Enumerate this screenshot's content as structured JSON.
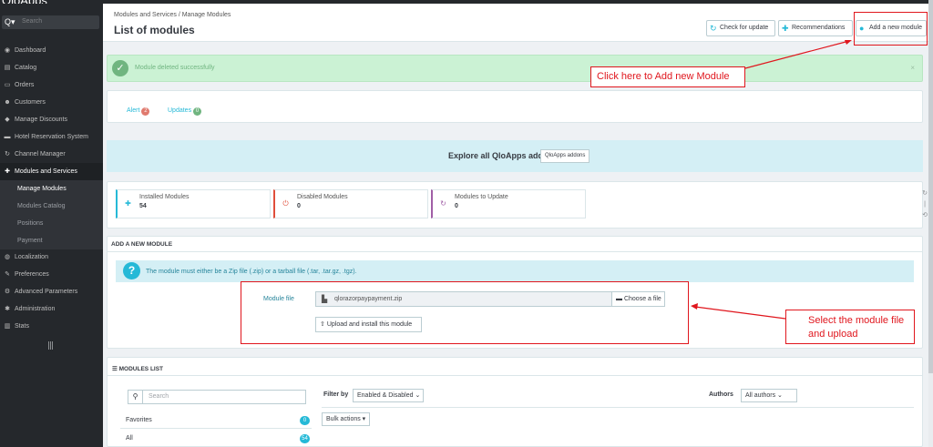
{
  "app": {
    "logo_text": "QloApps"
  },
  "sidebar": {
    "search_placeholder": "Search",
    "search_icon_text": "Q▾",
    "items": [
      {
        "label": "Dashboard",
        "icon": "dashboard-icon",
        "glyph": "◉"
      },
      {
        "label": "Catalog",
        "icon": "book-icon",
        "glyph": "▤"
      },
      {
        "label": "Orders",
        "icon": "credit-card-icon",
        "glyph": "▭"
      },
      {
        "label": "Customers",
        "icon": "users-icon",
        "glyph": "☻"
      },
      {
        "label": "Manage Discounts",
        "icon": "tag-icon",
        "glyph": "◆"
      },
      {
        "label": "Hotel Reservation System",
        "icon": "bed-icon",
        "glyph": "▬"
      },
      {
        "label": "Channel Manager",
        "icon": "refresh-icon",
        "glyph": "↻"
      },
      {
        "label": "Modules and Services",
        "icon": "puzzle-icon",
        "glyph": "✚"
      },
      {
        "label": "Localization",
        "icon": "globe-icon",
        "glyph": "◍"
      },
      {
        "label": "Preferences",
        "icon": "wrench-icon",
        "glyph": "✎"
      },
      {
        "label": "Advanced Parameters",
        "icon": "cogs-icon",
        "glyph": "⚙"
      },
      {
        "label": "Administration",
        "icon": "gear-icon",
        "glyph": "✱"
      },
      {
        "label": "Stats",
        "icon": "bar-chart-icon",
        "glyph": "▥"
      }
    ],
    "subitems": [
      {
        "label": "Manage Modules"
      },
      {
        "label": "Modules Catalog"
      },
      {
        "label": "Positions"
      },
      {
        "label": "Payment"
      }
    ]
  },
  "header": {
    "breadcrumb": "Modules and Services  /  Manage Modules",
    "title": "List of modules",
    "buttons": {
      "check_update": "Check for update",
      "recommendations": "Recommendations",
      "add_module": "Add a new module"
    }
  },
  "alert": {
    "message": "Module deleted successfully",
    "close": "×"
  },
  "tabs": {
    "alert_label": "Alert",
    "alert_count": "2",
    "updates_label": "Updates",
    "updates_count": "0"
  },
  "addons": {
    "text": "Explore all QloApps addons",
    "button": "QloApps addons"
  },
  "kpis": [
    {
      "label": "Installed Modules",
      "value": "54",
      "color": "#25b9d7",
      "icon": "puzzle-icon"
    },
    {
      "label": "Disabled Modules",
      "value": "0",
      "color": "#e04e3a",
      "icon": "power-icon"
    },
    {
      "label": "Modules to Update",
      "value": "0",
      "color": "#a05ea6",
      "icon": "refresh-icon"
    }
  ],
  "add_module": {
    "heading": "ADD A NEW MODULE",
    "info": "The module must either be a Zip file (.zip) or a tarball file (.tar, .tar.gz, .tgz).",
    "field_label": "Module file",
    "file_name": "qlorazorpaypayment.zip",
    "choose_button": "Choose a file",
    "upload_button": "Upload and install this module"
  },
  "modules_list": {
    "heading": "MODULES LIST",
    "search_placeholder": "Search",
    "categories": [
      {
        "label": "Favorites",
        "count": "0"
      },
      {
        "label": "All",
        "count": "54"
      }
    ],
    "filter_by_label": "Filter by",
    "filter_value": "Enabled & Disabled",
    "authors_label": "Authors",
    "authors_value": "All authors",
    "bulk_actions": "Bulk actions ▾"
  },
  "annotations": {
    "add_module_callout": "Click here to Add new Module",
    "upload_callout_line1": "Select the module file",
    "upload_callout_line2": "and upload"
  },
  "colors": {
    "accent": "#25b9d7",
    "annotation_red": "#e0161d",
    "sidebar_bg": "#25282c"
  }
}
